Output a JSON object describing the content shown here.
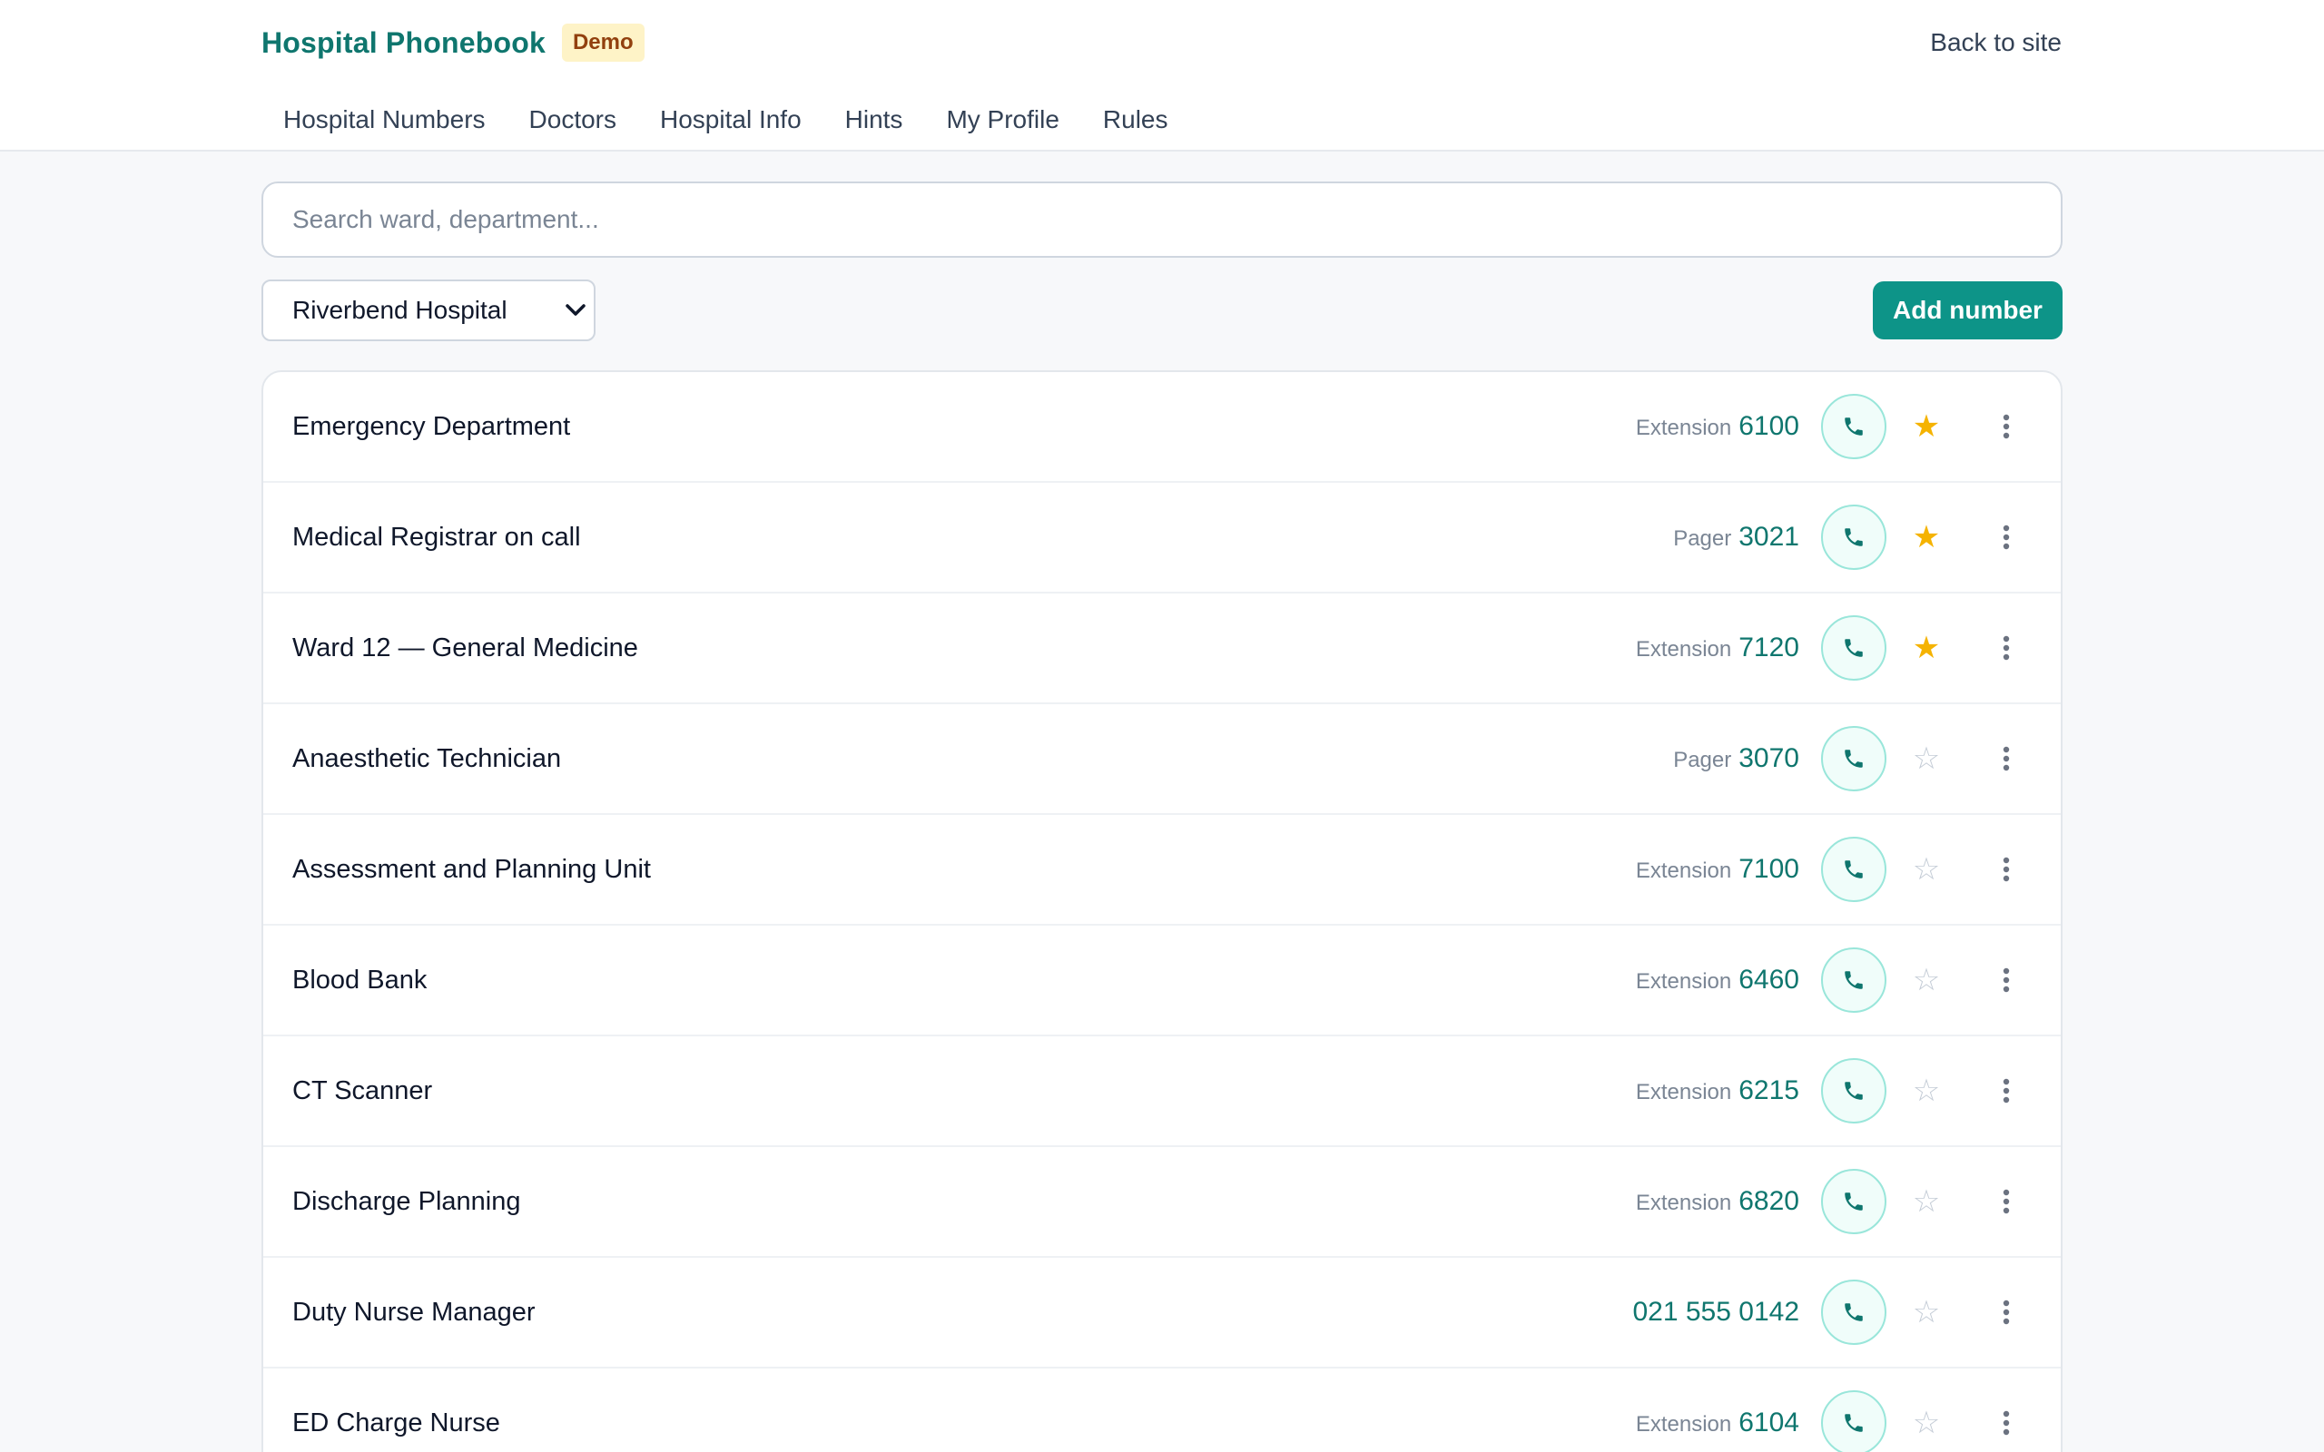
{
  "header": {
    "title": "Hospital Phonebook",
    "badge": "Demo",
    "back_link": "Back to site"
  },
  "nav": [
    {
      "label": "Hospital Numbers"
    },
    {
      "label": "Doctors"
    },
    {
      "label": "Hospital Info"
    },
    {
      "label": "Hints"
    },
    {
      "label": "My Profile"
    },
    {
      "label": "Rules"
    }
  ],
  "search": {
    "placeholder": "Search ward, department...",
    "value": ""
  },
  "hospital_select": {
    "selected": "Riverbend Hospital"
  },
  "add_button": "Add number",
  "colors": {
    "brand": "#0f766e",
    "accent": "#0d9488",
    "star_active": "#f5b301",
    "star_inactive": "#c4ccd6"
  },
  "icons": {
    "call": "phone-icon",
    "favorite": "star-icon",
    "more": "kebab-menu-icon",
    "select": "chevron-down-icon"
  },
  "entries": [
    {
      "name": "Emergency Department",
      "kind": "Extension",
      "number": "6100",
      "favorite": true
    },
    {
      "name": "Medical Registrar on call",
      "kind": "Pager",
      "number": "3021",
      "favorite": true
    },
    {
      "name": "Ward 12 — General Medicine",
      "kind": "Extension",
      "number": "7120",
      "favorite": true
    },
    {
      "name": "Anaesthetic Technician",
      "kind": "Pager",
      "number": "3070",
      "favorite": false
    },
    {
      "name": "Assessment and Planning Unit",
      "kind": "Extension",
      "number": "7100",
      "favorite": false
    },
    {
      "name": "Blood Bank",
      "kind": "Extension",
      "number": "6460",
      "favorite": false
    },
    {
      "name": "CT Scanner",
      "kind": "Extension",
      "number": "6215",
      "favorite": false
    },
    {
      "name": "Discharge Planning",
      "kind": "Extension",
      "number": "6820",
      "favorite": false
    },
    {
      "name": "Duty Nurse Manager",
      "kind": "",
      "number": "021 555 0142",
      "favorite": false
    },
    {
      "name": "ED Charge Nurse",
      "kind": "Extension",
      "number": "6104",
      "favorite": false
    }
  ]
}
